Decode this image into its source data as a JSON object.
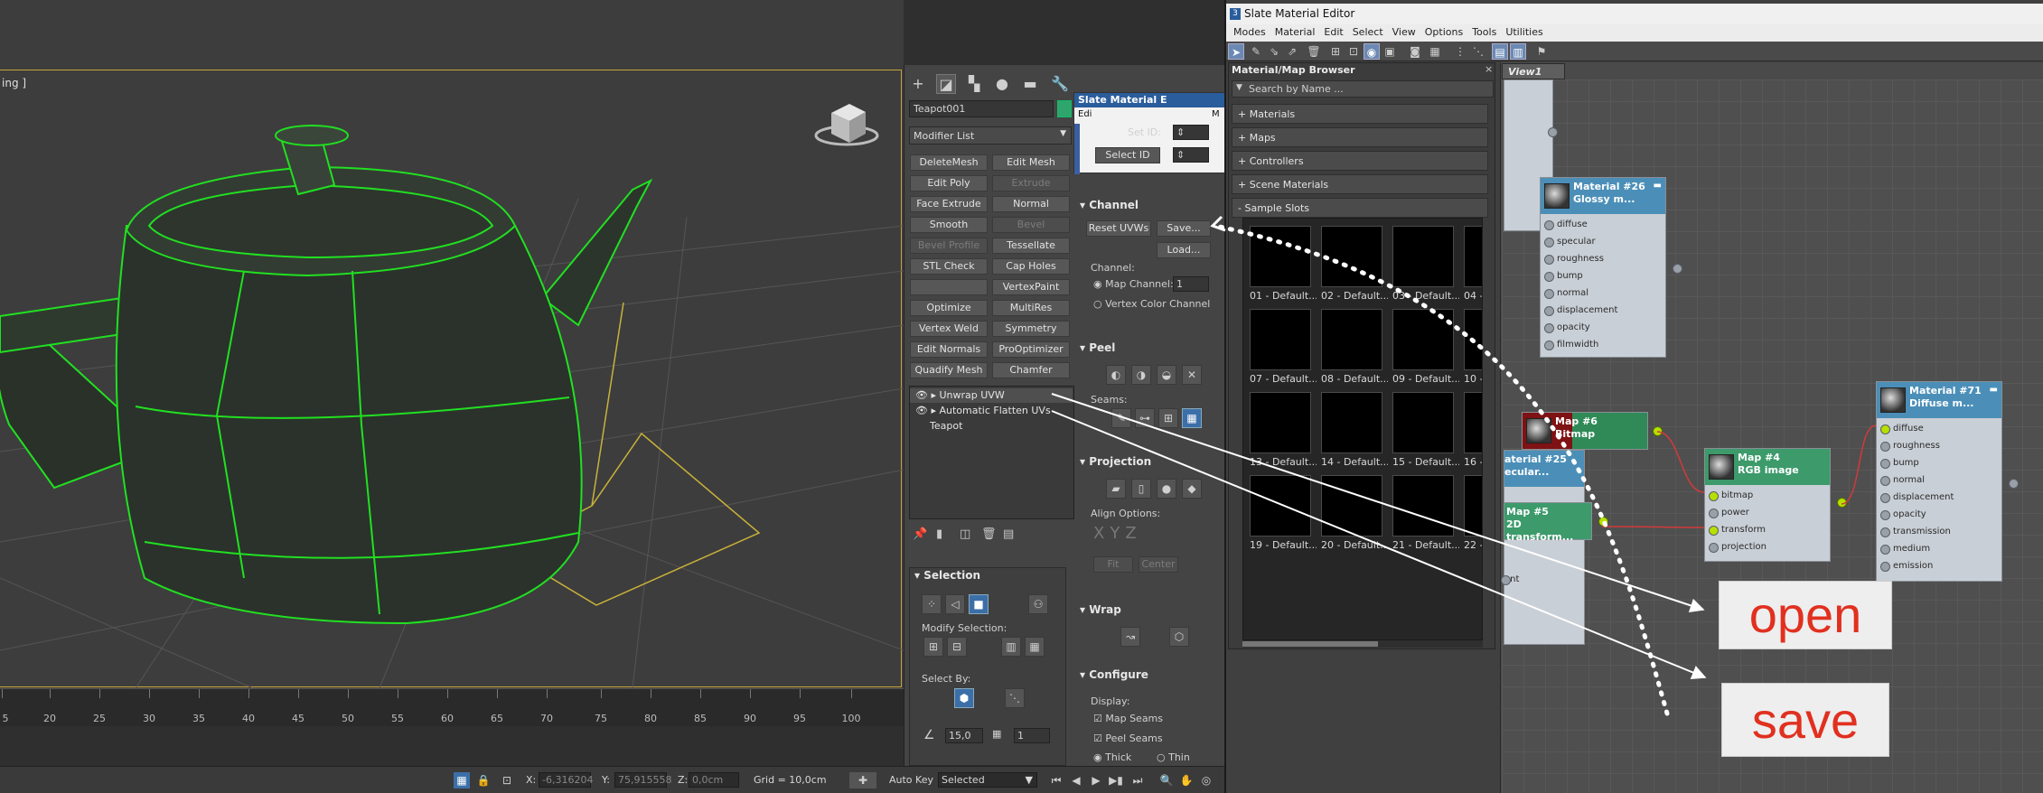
{
  "viewport": {
    "label": "ing ]"
  },
  "ruler": {
    "ticks": [
      "5",
      "20",
      "25",
      "30",
      "35",
      "40",
      "45",
      "50",
      "55",
      "60",
      "65",
      "70",
      "75",
      "80",
      "85",
      "90",
      "95",
      "100"
    ]
  },
  "command_panel": {
    "object_name": "Teapot001",
    "modifier_list": "Modifier List",
    "buttons": [
      {
        "label": "DeleteMesh",
        "enabled": true
      },
      {
        "label": "Edit Mesh",
        "enabled": true
      },
      {
        "label": "Edit Poly",
        "enabled": true
      },
      {
        "label": "Extrude",
        "enabled": false
      },
      {
        "label": "Face Extrude",
        "enabled": true
      },
      {
        "label": "Normal",
        "enabled": true
      },
      {
        "label": "Smooth",
        "enabled": true
      },
      {
        "label": "Bevel",
        "enabled": false
      },
      {
        "label": "Bevel Profile",
        "enabled": false
      },
      {
        "label": "Tessellate",
        "enabled": true
      },
      {
        "label": "STL Check",
        "enabled": true
      },
      {
        "label": "Cap Holes",
        "enabled": true
      },
      {
        "label": "",
        "enabled": true
      },
      {
        "label": "VertexPaint",
        "enabled": true
      },
      {
        "label": "Optimize",
        "enabled": true
      },
      {
        "label": "MultiRes",
        "enabled": true
      },
      {
        "label": "Vertex Weld",
        "enabled": true
      },
      {
        "label": "Symmetry",
        "enabled": true
      },
      {
        "label": "Edit Normals",
        "enabled": true
      },
      {
        "label": "ProOptimizer",
        "enabled": true
      },
      {
        "label": "Quadify Mesh",
        "enabled": true
      },
      {
        "label": "Chamfer",
        "enabled": true
      }
    ],
    "stack": {
      "item1": "Unwrap UVW",
      "item2": "Automatic Flatten UVs",
      "item3": "Teapot"
    },
    "mini_window": {
      "title": "Slate Material E",
      "edit": "Edi",
      "m": "M"
    },
    "set_id": "Set ID:",
    "select_id": "Select ID",
    "channel": {
      "header": "Channel",
      "reset_uvws": "Reset UVWs",
      "save": "Save...",
      "load": "Load...",
      "channel_label": "Channel:",
      "map_channel": "Map Channel:",
      "map_channel_value": "1",
      "vertex_color": "Vertex Color Channel"
    },
    "peel": {
      "header": "Peel",
      "seams": "Seams:"
    },
    "projection": {
      "header": "Projection",
      "align_options": "Align Options:",
      "fit": "Fit",
      "center": "Center"
    },
    "wrap": {
      "header": "Wrap"
    },
    "configure": {
      "header": "Configure",
      "display": "Display:",
      "map_seams": "Map Seams",
      "peel_seams": "Peel Seams",
      "thick": "Thick",
      "thin": "Thin"
    },
    "selection": {
      "header": "Selection",
      "modify_selection": "Modify Selection:",
      "select_by": "Select By:",
      "spin1": "15,0",
      "spin2": "1"
    }
  },
  "slate": {
    "title": "Slate Material Editor",
    "menu": [
      "Modes",
      "Material",
      "Edit",
      "Select",
      "View",
      "Options",
      "Tools",
      "Utilities"
    ],
    "browser": {
      "title": "Material/Map Browser",
      "close": "×",
      "search_placeholder": "Search by Name ...",
      "categories": [
        "+ Materials",
        "+ Maps",
        "+ Controllers",
        "+ Scene Materials",
        "- Sample Slots"
      ],
      "slots": [
        "01 - Default...",
        "02 - Default...",
        "03 - Default...",
        "04 -",
        "07 - Default...",
        "08 - Default...",
        "09 - Default...",
        "10 -",
        "13 - Default...",
        "14 - Default...",
        "15 - Default...",
        "16 -",
        "19 - Default...",
        "20 - Default...",
        "21 - Default...",
        "22 -"
      ]
    },
    "view_tab": "View1",
    "nodes": {
      "mat26": {
        "title1": "Material #26",
        "title2": "Glossy m...",
        "ports": [
          "diffuse",
          "specular",
          "roughness",
          "bump",
          "normal",
          "displacement",
          "opacity",
          "filmwidth"
        ]
      },
      "map6": {
        "title1": "Map #6",
        "title2": "Bitmap"
      },
      "mat25": {
        "title1": "aterial #25",
        "title2": "ecular..."
      },
      "map5": {
        "title1": "Map #5",
        "title2": "2D transform..."
      },
      "map5_port": "ant",
      "map4": {
        "title1": "Map #4",
        "title2": "RGB image",
        "ports": [
          "bitmap",
          "power",
          "transform",
          "projection"
        ]
      },
      "mat71": {
        "title1": "Material #71",
        "title2": "Diffuse m...",
        "ports": [
          "diffuse",
          "roughness",
          "bump",
          "normal",
          "displacement",
          "opacity",
          "transmission",
          "medium",
          "emission"
        ]
      }
    }
  },
  "annotations": {
    "open": "open",
    "save": "save"
  },
  "status": {
    "x_label": "X:",
    "x_value": "-6,316204",
    "y_label": "Y:",
    "y_value": "75,915558",
    "z_label": "Z:",
    "z_value": "0,0cm",
    "grid": "Grid = 10,0cm",
    "auto_key": "Auto Key",
    "selected": "Selected"
  },
  "colors": {
    "accent": "#3c6fa8",
    "wire": "#22e022",
    "annotation_text": "#e1301f"
  }
}
